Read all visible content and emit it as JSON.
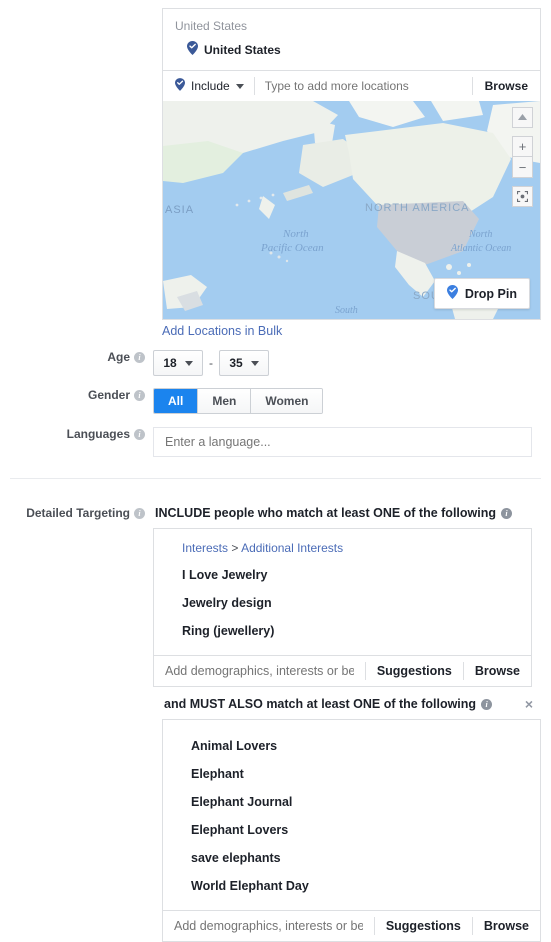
{
  "locations": {
    "group_header": "United States",
    "selected": "United States",
    "selected_icon": "map-pin-icon",
    "include_label": "Include",
    "include_icon": "map-pin-icon",
    "input_placeholder": "Type to add more locations",
    "browse_label": "Browse",
    "bulk_link": "Add Locations in Bulk"
  },
  "map": {
    "drop_pin_label": "Drop Pin",
    "drop_pin_icon": "map-pin-icon",
    "controls": {
      "compass": "compass-icon",
      "zoom_in": "+",
      "zoom_out": "−",
      "recenter": "recenter-icon"
    },
    "labels": {
      "asia": "ASIA",
      "north_america": "NORTH AMERICA",
      "south_america": "SOUTH AMERICA",
      "north_pacific": "North\nPacific Ocean",
      "north_atlantic": "North\nAtlantic Ocean",
      "south": "South"
    },
    "colors": {
      "ocean": "#a3ccf0",
      "land": "#f2f4f1",
      "land_green": "#e3efdf",
      "highlight": "#c6ccd4",
      "pin": "#3b5998"
    }
  },
  "age": {
    "label": "Age",
    "min": "18",
    "max": "35",
    "separator": "-"
  },
  "gender": {
    "label": "Gender",
    "options": [
      "All",
      "Men",
      "Women"
    ],
    "selected": "All",
    "selected_color": "#1b84ee"
  },
  "languages": {
    "label": "Languages",
    "placeholder": "Enter a language...",
    "value": ""
  },
  "detailed_targeting": {
    "label": "Detailed Targeting",
    "include_heading": "INCLUDE people who match at least ONE of the following",
    "and_heading": "and MUST ALSO match at least ONE of the following",
    "close_icon": "×",
    "include_box": {
      "breadcrumb_root": "Interests",
      "breadcrumb_sep": ">",
      "breadcrumb_leaf": "Additional Interests",
      "items": [
        "I Love Jewelry",
        "Jewelry design",
        "Ring (jewellery)"
      ],
      "input_placeholder": "Add demographics, interests or beha...",
      "suggestions_label": "Suggestions",
      "browse_label": "Browse"
    },
    "and_box": {
      "items": [
        "Animal Lovers",
        "Elephant",
        "Elephant Journal",
        "Elephant Lovers",
        "save elephants",
        "World Elephant Day"
      ],
      "input_placeholder": "Add demographics, interests or beha...",
      "suggestions_label": "Suggestions",
      "browse_label": "Browse"
    }
  }
}
